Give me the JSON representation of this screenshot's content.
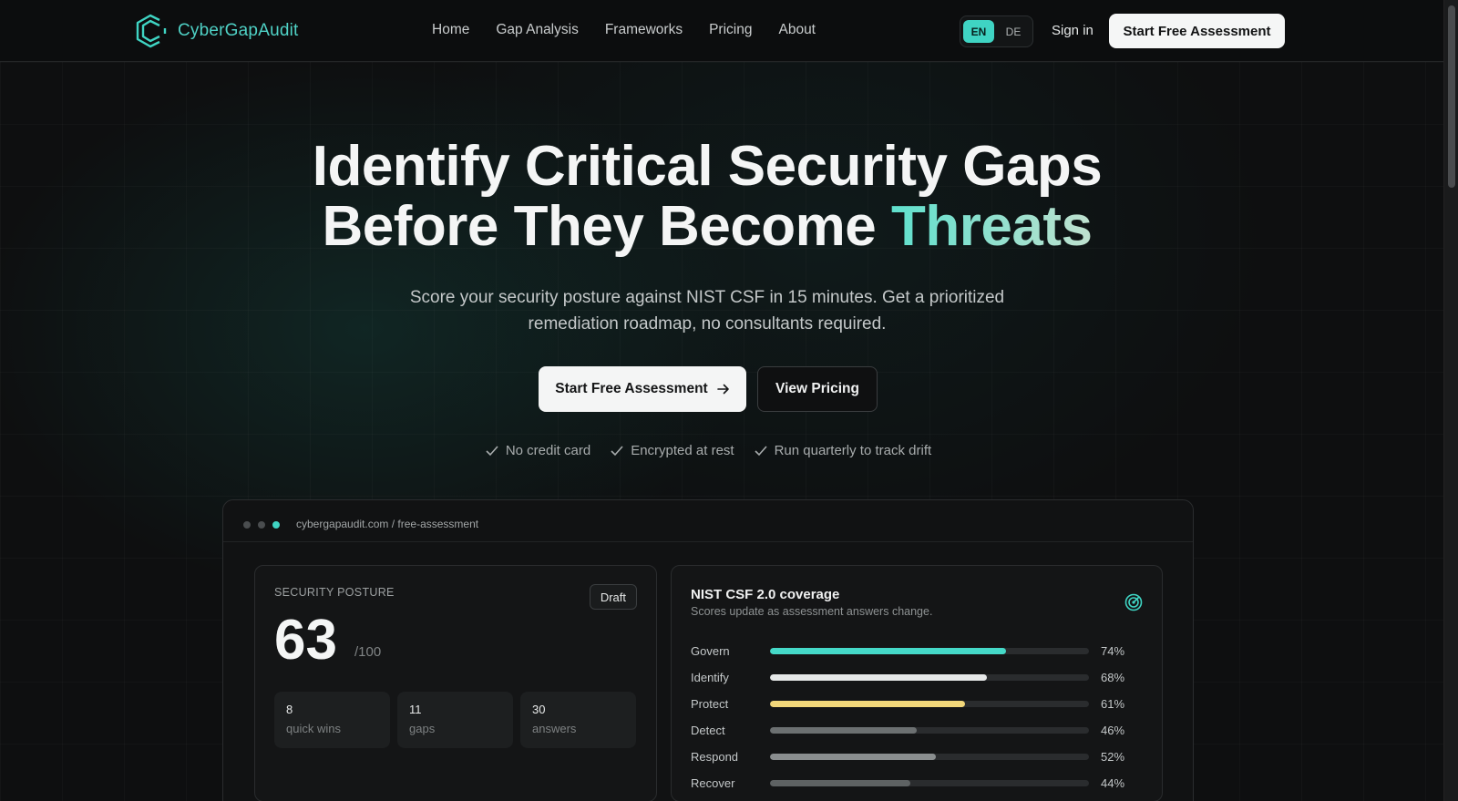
{
  "nav": {
    "brand": "CyberGapAudit",
    "links": [
      "Home",
      "Gap Analysis",
      "Frameworks",
      "Pricing",
      "About"
    ],
    "lang_active": "EN",
    "lang_other": "DE",
    "signin": "Sign in",
    "cta": "Start Free Assessment"
  },
  "hero": {
    "title_line1": "Identify Critical Security Gaps",
    "title_line2_plain": "Before They Become ",
    "title_line2_accent": "Threats",
    "subtitle_line1": "Score your security posture against NIST CSF in 15 minutes. Get a prioritized",
    "subtitle_line2": "remediation roadmap, no consultants required.",
    "primary_cta": "Start Free Assessment",
    "secondary_cta": "View Pricing",
    "checks": [
      "No credit card",
      "Encrypted at rest",
      "Run quarterly to track drift"
    ]
  },
  "preview": {
    "url": "cybergapaudit.com / free-assessment",
    "posture": {
      "label": "SECURITY POSTURE",
      "badge": "Draft",
      "score": "63",
      "max": "/100",
      "stats": [
        {
          "n": "8",
          "l": "quick wins"
        },
        {
          "n": "11",
          "l": "gaps"
        },
        {
          "n": "30",
          "l": "answers"
        }
      ]
    },
    "coverage": {
      "title": "NIST CSF 2.0 coverage",
      "subtitle": "Scores update as assessment answers change.",
      "icon": "target-icon",
      "rows": [
        {
          "name": "Govern",
          "value": 74,
          "label": "74%",
          "color": "#45d9c8"
        },
        {
          "name": "Identify",
          "value": 68,
          "label": "68%",
          "color": "#e6e8e8"
        },
        {
          "name": "Protect",
          "value": 61,
          "label": "61%",
          "color": "#f2d77a"
        },
        {
          "name": "Detect",
          "value": 46,
          "label": "46%",
          "color": "#6c7071"
        },
        {
          "name": "Respond",
          "value": 52,
          "label": "52%",
          "color": "#8a8e8f"
        },
        {
          "name": "Recover",
          "value": 44,
          "label": "44%",
          "color": "#5e6263"
        }
      ]
    }
  },
  "colors": {
    "accent": "#3fd4c3",
    "background": "#0e0f10"
  }
}
